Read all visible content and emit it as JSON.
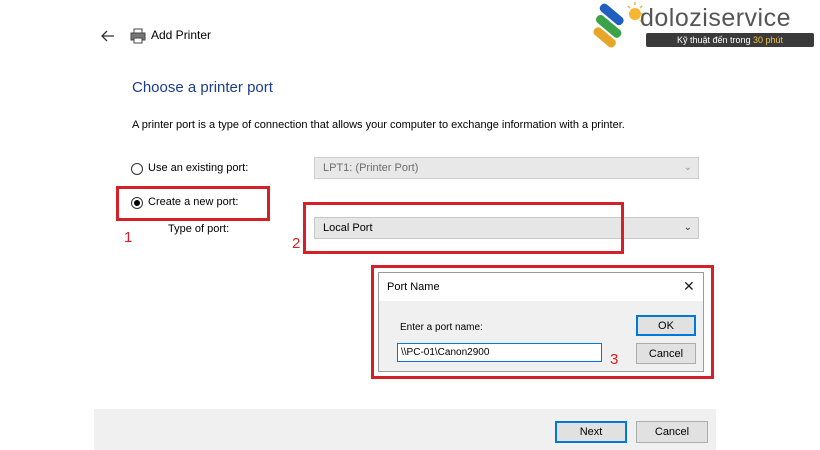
{
  "header": {
    "title": "Add Printer",
    "back_icon": "arrow-left-icon",
    "printer_icon": "printer-icon"
  },
  "logo": {
    "name": "doloziservice",
    "tagline_prefix": "Kỹ thuật đến trong",
    "tagline_highlight": "30 phút"
  },
  "page": {
    "heading": "Choose a printer port",
    "description": "A printer port is a type of connection that allows your computer to exchange information with a printer."
  },
  "options": {
    "existing_label": "Use an existing port:",
    "existing_value": "LPT1: (Printer Port)",
    "new_label": "Create a new port:",
    "type_label": "Type of port:",
    "type_value": "Local Port"
  },
  "annotations": {
    "one": "1",
    "two": "2",
    "three": "3"
  },
  "dialog": {
    "title": "Port Name",
    "close": "✕",
    "prompt": "Enter a port name:",
    "value": "\\\\PC-01\\Canon2900",
    "ok": "OK",
    "cancel": "Cancel"
  },
  "footer": {
    "next": "Next",
    "cancel": "Cancel"
  },
  "colors": {
    "accent_heading": "#1c3d88",
    "annotation_red": "#d42027",
    "focus_blue": "#0078d7"
  }
}
